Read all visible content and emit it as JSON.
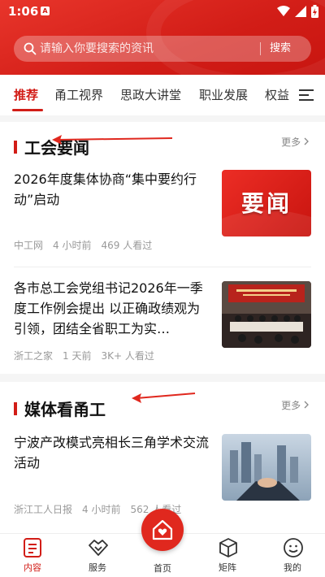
{
  "status_bar": {
    "time": "1:06",
    "notif_badge": "A"
  },
  "search": {
    "placeholder": "请输入你要搜索的资讯",
    "button": "搜索"
  },
  "tabs": [
    {
      "label": "推荐",
      "active": true
    },
    {
      "label": "甬工视界"
    },
    {
      "label": "思政大讲堂"
    },
    {
      "label": "职业发展"
    },
    {
      "label": "权益"
    }
  ],
  "sections": [
    {
      "title": "工会要闻",
      "more": "更多",
      "items": [
        {
          "title": "2026年度集体协商“集中要约行动”启动",
          "source": "中工网",
          "time": "4 小时前",
          "views": "469 人看过",
          "thumb_text": "要闻"
        },
        {
          "title": "各市总工会党组书记2026年一季度工作例会提出 以正确政绩观为引领，团结全省职工为实…",
          "source": "浙工之家",
          "time": "1 天前",
          "views": "3K+ 人看过"
        }
      ]
    },
    {
      "title": "媒体看甬工",
      "more": "更多",
      "items": [
        {
          "title": "宁波产改模式亮相长三角学术交流活动",
          "source": "浙江工人日报",
          "time": "4 小时前",
          "views": "562 人看过"
        }
      ]
    }
  ],
  "bottom_nav": [
    {
      "label": "内容",
      "icon": "content-icon",
      "active": true
    },
    {
      "label": "服务",
      "icon": "handshake-icon"
    },
    {
      "label": "首页",
      "icon": "home-heart-icon"
    },
    {
      "label": "矩阵",
      "icon": "cube-icon"
    },
    {
      "label": "我的",
      "icon": "profile-icon"
    }
  ],
  "colors": {
    "brand": "#d21d17",
    "annotation": "#e0281e"
  }
}
